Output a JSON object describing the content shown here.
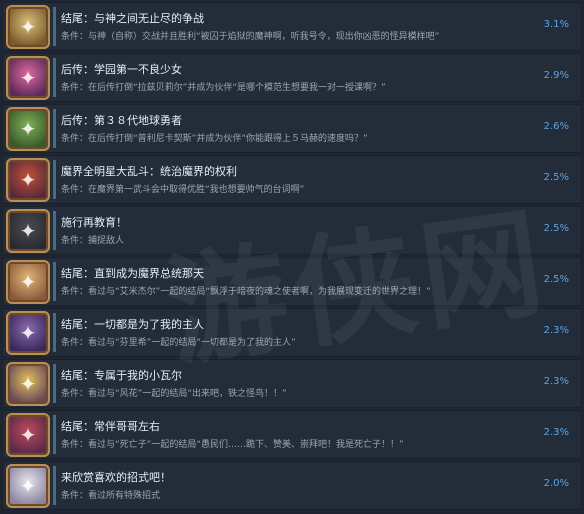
{
  "achievements": [
    {
      "title": "结尾：与神之间无止尽的争战",
      "desc": "条件：与神（自称）交战并且胜利“被囚于焰狱的魔神啊，听我号令，现出你凶恶的怪异模样吧”",
      "pct": "3.1%",
      "icon": "demon-character-icon",
      "c1": "#d9c07a",
      "c2": "#7a5a2a"
    },
    {
      "title": "后传：学园第一不良少女",
      "desc": "条件：在后传打倒“拉兹贝莉尔”并成为伙伴“是哪个模范生想要我一对一授课啊？”",
      "pct": "2.9%",
      "icon": "pink-hair-girl-icon",
      "c1": "#e06aa0",
      "c2": "#5a2a5a"
    },
    {
      "title": "后传：第３８代地球勇者",
      "desc": "条件：在后传打倒“普利尼卡契斯”并成为伙伴“你能跟得上５马赫的速度吗？”",
      "pct": "2.6%",
      "icon": "green-hero-icon",
      "c1": "#7fb05a",
      "c2": "#3a5a2a"
    },
    {
      "title": "魔界全明星大乱斗：统治魔界的权利",
      "desc": "条件：在魔界第一武斗会中取得优胜“我也想要帅气的台词啊”",
      "pct": "2.5%",
      "icon": "red-armor-warrior-icon",
      "c1": "#c0503a",
      "c2": "#5a2a3a"
    },
    {
      "title": "施行再教育！",
      "desc": "条件：捕捉敌人",
      "pct": "2.5%",
      "icon": "dark-cloak-figure-icon",
      "c1": "#4a4a52",
      "c2": "#2a2a30"
    },
    {
      "title": "结尾：直到成为魔界总统那天",
      "desc": "条件：看过与“艾米杰尔”一起的结局“飘浮于暗夜的魂之使者啊，为我展现变迁的世界之理！”",
      "pct": "2.5%",
      "icon": "angel-girl-icon",
      "c1": "#e0b87a",
      "c2": "#8a5a3a"
    },
    {
      "title": "结尾：一切都是为了我的主人",
      "desc": "条件：看过与“芬里希”一起的结局“一切都是为了我的主人”",
      "pct": "2.3%",
      "icon": "purple-maid-icon",
      "c1": "#8a6ab0",
      "c2": "#3a2a5a"
    },
    {
      "title": "结尾：专属于我的小瓦尔",
      "desc": "条件：看过与“风花”一起的结局“出来吧，铁之怪鸟！！”",
      "pct": "2.3%",
      "icon": "blonde-girl-icon",
      "c1": "#e0c05a",
      "c2": "#6a4a5a"
    },
    {
      "title": "结尾：常伴哥哥左右",
      "desc": "条件：看过与“死亡子”一起的结局“愚民们……跪下、赞美、崇拜吧！我是死亡子！！”",
      "pct": "2.3%",
      "icon": "red-dress-girl-icon",
      "c1": "#c04a5a",
      "c2": "#5a2a4a"
    },
    {
      "title": "来欣赏喜欢的招式吧！",
      "desc": "条件：看过所有特殊招式",
      "pct": "2.0%",
      "icon": "white-robe-character-icon",
      "c1": "#e8e4ec",
      "c2": "#8a84a0"
    }
  ],
  "watermark": "游侠网"
}
